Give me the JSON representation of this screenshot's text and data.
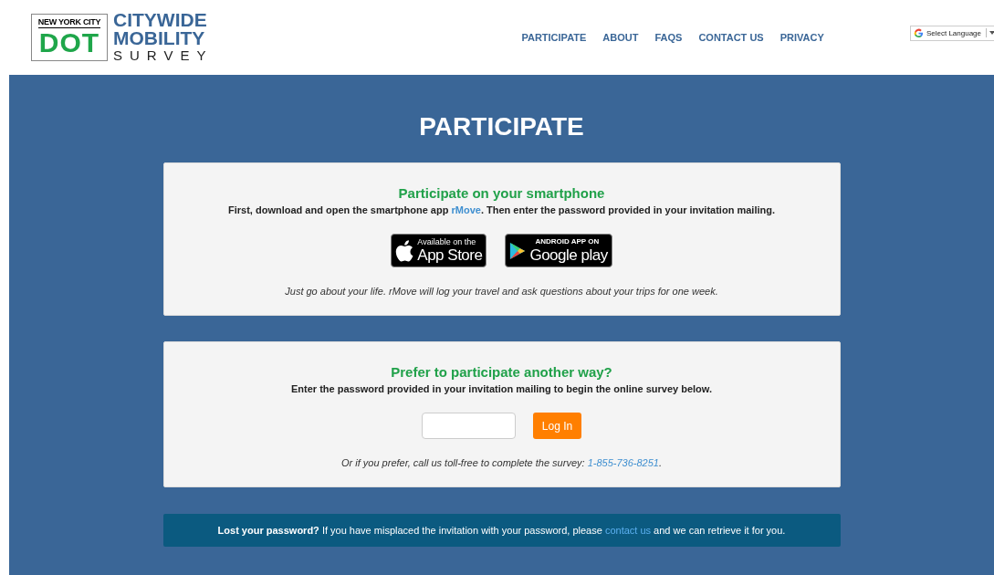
{
  "header": {
    "logo": {
      "city": "NEW YORK CITY",
      "mark": "DOT",
      "title_lines": [
        "CITYWIDE",
        "MOBILITY"
      ],
      "subtitle": "SURVEY"
    },
    "nav": [
      {
        "label": "PARTICIPATE"
      },
      {
        "label": "ABOUT"
      },
      {
        "label": "FAQS"
      },
      {
        "label": "CONTACT US"
      },
      {
        "label": "PRIVACY"
      }
    ],
    "language": {
      "label": "Select Language"
    }
  },
  "page_title": "PARTICIPATE",
  "smartphone": {
    "heading": "Participate on your smartphone",
    "text_before": "First, download and open the smartphone app ",
    "link": "rMove",
    "text_after": ". Then enter the password provided in your invitation mailing.",
    "badges": [
      {
        "kind": "apple",
        "top": "Available on the",
        "bottom": "App Store"
      },
      {
        "kind": "google",
        "top": "ANDROID APP ON",
        "bottom": "Google play"
      }
    ],
    "note": "Just go about your life. rMove will log your travel and ask questions about your trips for one week."
  },
  "other": {
    "heading": "Prefer to participate another way?",
    "text": "Enter the password provided in your invitation mailing to begin the online survey below.",
    "button": "Log In",
    "phone_before": "Or if you prefer, call us toll-free to complete the survey: ",
    "phone": "1-855-736-8251",
    "phone_after": "."
  },
  "lost": {
    "bold": "Lost your password?",
    "text_before": " If you have misplaced the invitation with your password, please ",
    "link": "contact us",
    "text_after": " and we can retrieve it for you."
  }
}
